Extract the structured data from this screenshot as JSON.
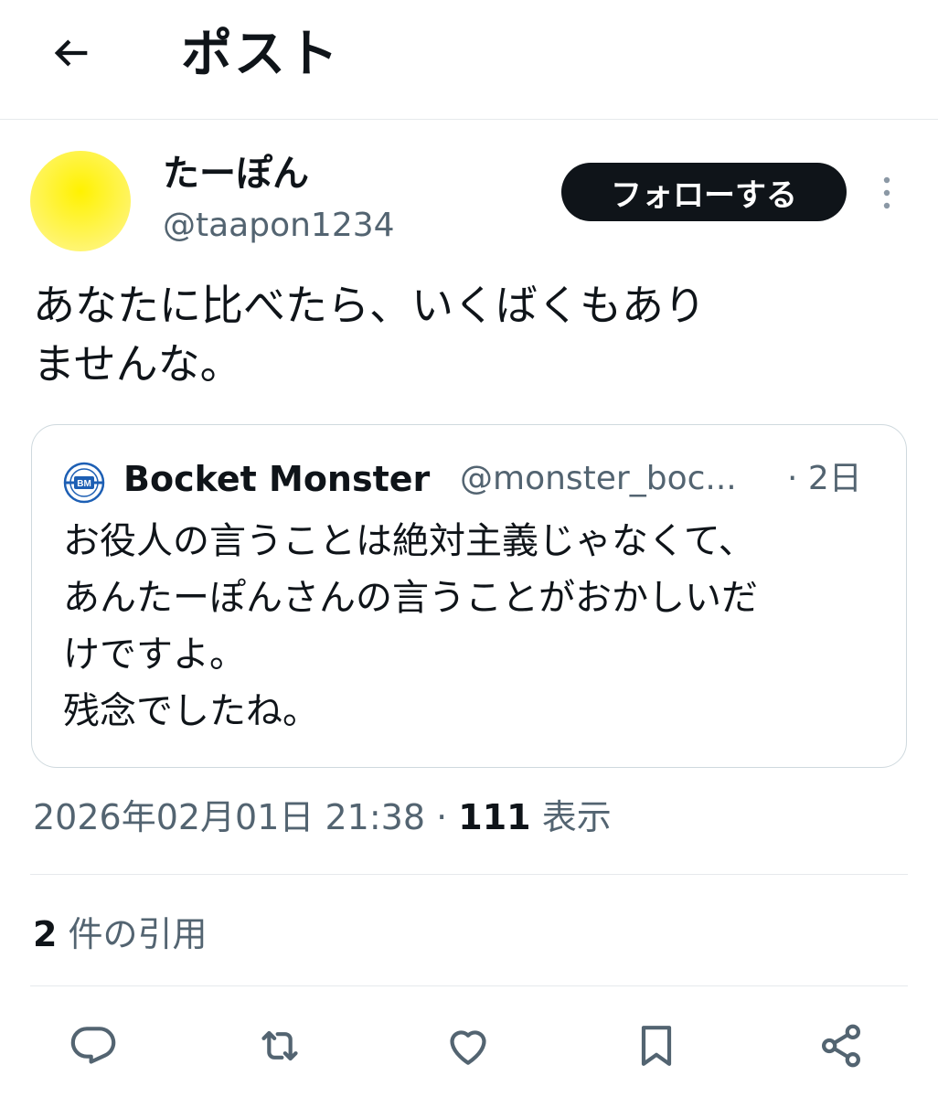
{
  "header": {
    "title": "ポスト",
    "back_icon": "arrow-left-icon"
  },
  "post": {
    "author": {
      "display_name": "たーぽん",
      "handle": "@taapon1234",
      "avatar_color": "#fff200"
    },
    "follow_label": "フォローする",
    "more_icon": "more-vertical-icon",
    "text": "あなたに比べたら、いくばくもあり\nませんな。",
    "quote": {
      "avatar_text": "BM",
      "display_name": "Bocket Monster",
      "handle": "@monster_boc...",
      "time": "· 2日",
      "text": "お役人の言うことは絶対主義じゃなくて、\nあんたーぽんさんの言うことがおかしいだ\nけですよ。\n残念でしたね。"
    },
    "timestamp": "2026年02月01日 21:38",
    "separator": "·",
    "views_count": "111",
    "views_label": "表示",
    "quotes_count": "2",
    "quotes_label": "件の引用"
  },
  "actions": {
    "reply_icon": "reply-icon",
    "repost_icon": "repost-icon",
    "like_icon": "heart-icon",
    "bookmark_icon": "bookmark-icon",
    "share_icon": "share-icon"
  },
  "colors": {
    "text_primary": "#0f1419",
    "text_secondary": "#536471",
    "border": "#cfd9de",
    "divider": "#e6e9ec",
    "follow_button_bg": "#0f1419",
    "quote_logo_blue": "#1d5fb4"
  }
}
